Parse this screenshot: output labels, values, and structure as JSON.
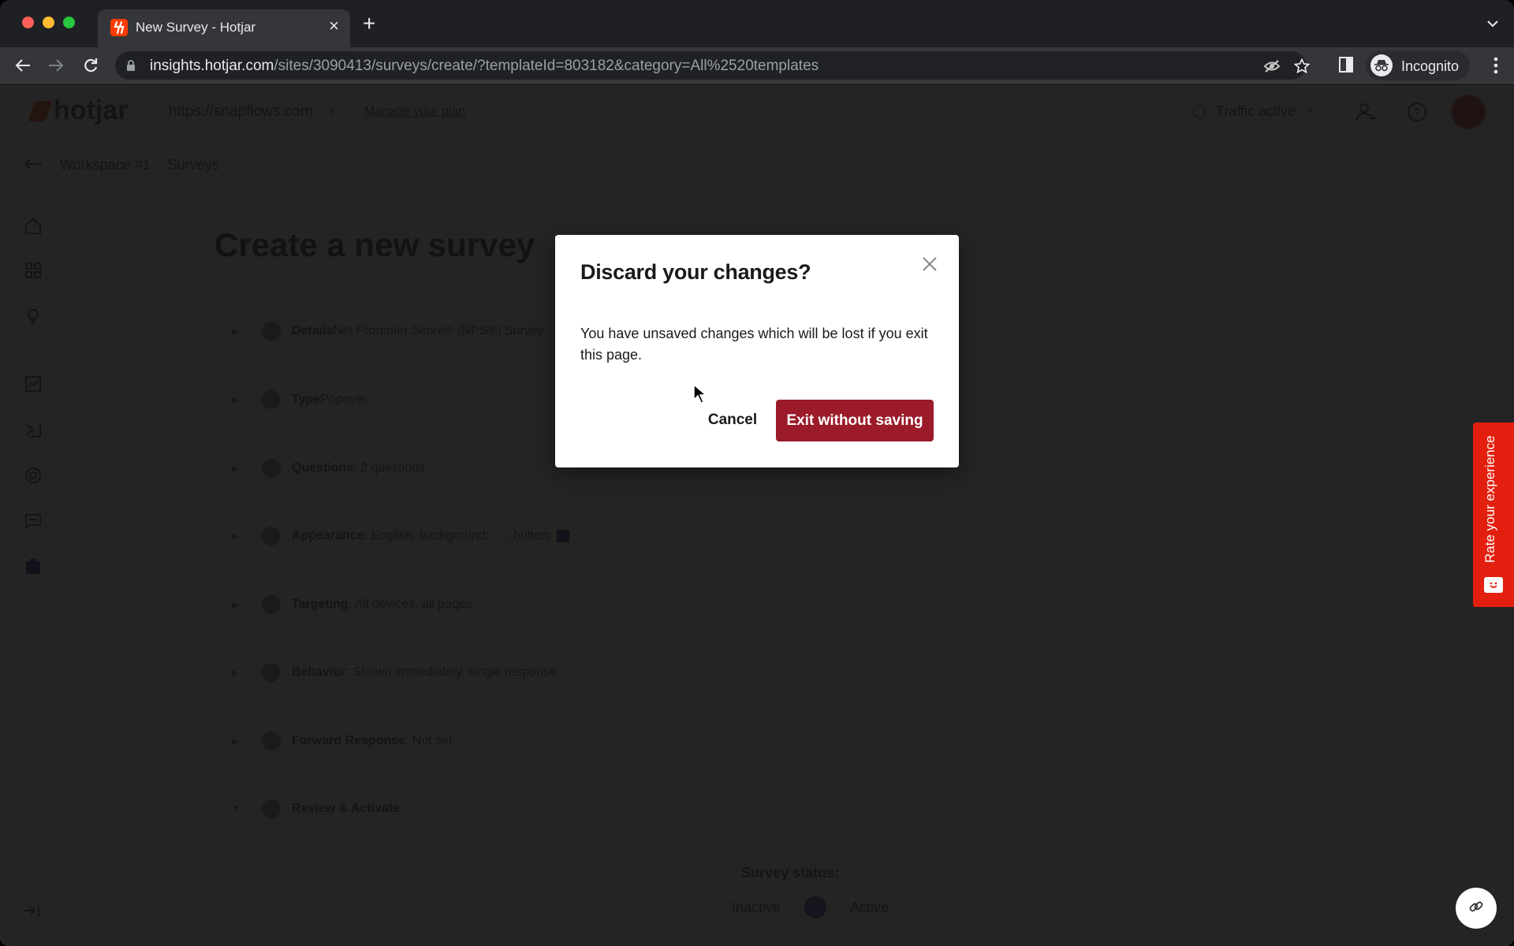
{
  "browser": {
    "tab_title": "New Survey - Hotjar",
    "url_host": "insights.hotjar.com",
    "url_path": "/sites/3090413/surveys/create/?templateId=803182&category=All%2520templates",
    "profile_label": "Incognito"
  },
  "app": {
    "logo_text": "hotjar",
    "site_selector": "https://snapflows.com",
    "manage_plan_link": "Manage your plan",
    "traffic_status": "Traffic active",
    "breadcrumb": [
      "Workspace #1",
      "Surveys"
    ],
    "page_title": "Create a new survey",
    "steps": [
      {
        "label": "Details",
        "value": " Net Promoter Score® (NPS®) Survey"
      },
      {
        "label": "Type",
        "value": " Popover"
      },
      {
        "label": "Questions",
        "value": ": 2 questions"
      },
      {
        "label": "Appearance",
        "value": ": English, background: ",
        "value_2": ", button: "
      },
      {
        "label": "Targeting",
        "value": ": All devices, all pages."
      },
      {
        "label": "Behavior",
        "value": ": Shown immediately, single response"
      },
      {
        "label": "Forward Response",
        "value": ": Not set."
      },
      {
        "label": "Review & Activate",
        "value": ""
      }
    ],
    "survey_status": {
      "label": "Survey status:",
      "inactive": "Inactive",
      "active": "Active",
      "selected": "Active"
    },
    "appearance_colors": {
      "background": "#f0f0f0",
      "button": "#1a237e"
    }
  },
  "widgets": {
    "rate_experience": "Rate your experience"
  },
  "modal": {
    "title": "Discard your changes?",
    "body": "You have unsaved changes which will be lost if you exit this page.",
    "cancel_label": "Cancel",
    "confirm_label": "Exit without saving"
  },
  "colors": {
    "brand": "#ff3c00",
    "danger_button": "#9b1b2a",
    "rate_tab": "#e3200f"
  }
}
